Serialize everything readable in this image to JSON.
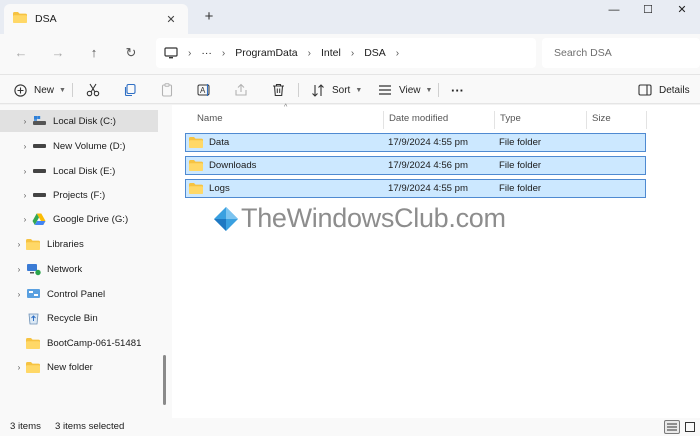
{
  "tab": {
    "title": "DSA",
    "close": "✕",
    "new_tab": "+"
  },
  "window_controls": {
    "minimize": "—",
    "maximize": "☐",
    "close": "✕"
  },
  "nav_buttons": {
    "back": "←",
    "forward": "→",
    "up": "↑",
    "refresh": "↻"
  },
  "address": {
    "overflow": "···",
    "segments": [
      "ProgramData",
      "Intel",
      "DSA"
    ],
    "separator": "›"
  },
  "search": {
    "placeholder": "Search DSA"
  },
  "toolbar": {
    "new_label": "New",
    "sort_label": "Sort",
    "view_label": "View",
    "more_label": "···",
    "details_label": "Details"
  },
  "sidebar": {
    "items": [
      {
        "label": "Local Disk (C:)",
        "icon": "drive-c-icon"
      },
      {
        "label": "New Volume (D:)",
        "icon": "drive-icon"
      },
      {
        "label": "Local Disk (E:)",
        "icon": "drive-icon"
      },
      {
        "label": "Projects (F:)",
        "icon": "drive-icon"
      },
      {
        "label": "Google Drive (G:)",
        "icon": "google-drive-icon"
      },
      {
        "label": "Libraries",
        "icon": "libraries-icon"
      },
      {
        "label": "Network",
        "icon": "network-icon"
      },
      {
        "label": "Control Panel",
        "icon": "control-panel-icon"
      },
      {
        "label": "Recycle Bin",
        "icon": "recycle-bin-icon"
      },
      {
        "label": "BootCamp-061-51481",
        "icon": "folder-icon"
      },
      {
        "label": "New folder",
        "icon": "folder-icon"
      }
    ]
  },
  "columns": {
    "name": "Name",
    "date": "Date modified",
    "type": "Type",
    "size": "Size",
    "sort_indicator": "^"
  },
  "files": [
    {
      "name": "Data",
      "date": "17/9/2024 4:55 pm",
      "type": "File folder"
    },
    {
      "name": "Downloads",
      "date": "17/9/2024 4:56 pm",
      "type": "File folder"
    },
    {
      "name": "Logs",
      "date": "17/9/2024 4:55 pm",
      "type": "File folder"
    }
  ],
  "watermark": {
    "text": "TheWindowsClub.com"
  },
  "status": {
    "item_count": "3 items",
    "selected": "3 items selected"
  },
  "colors": {
    "selection_fill": "#cce8ff",
    "selection_border": "#4f8ad1",
    "folder": "#f6c342"
  }
}
